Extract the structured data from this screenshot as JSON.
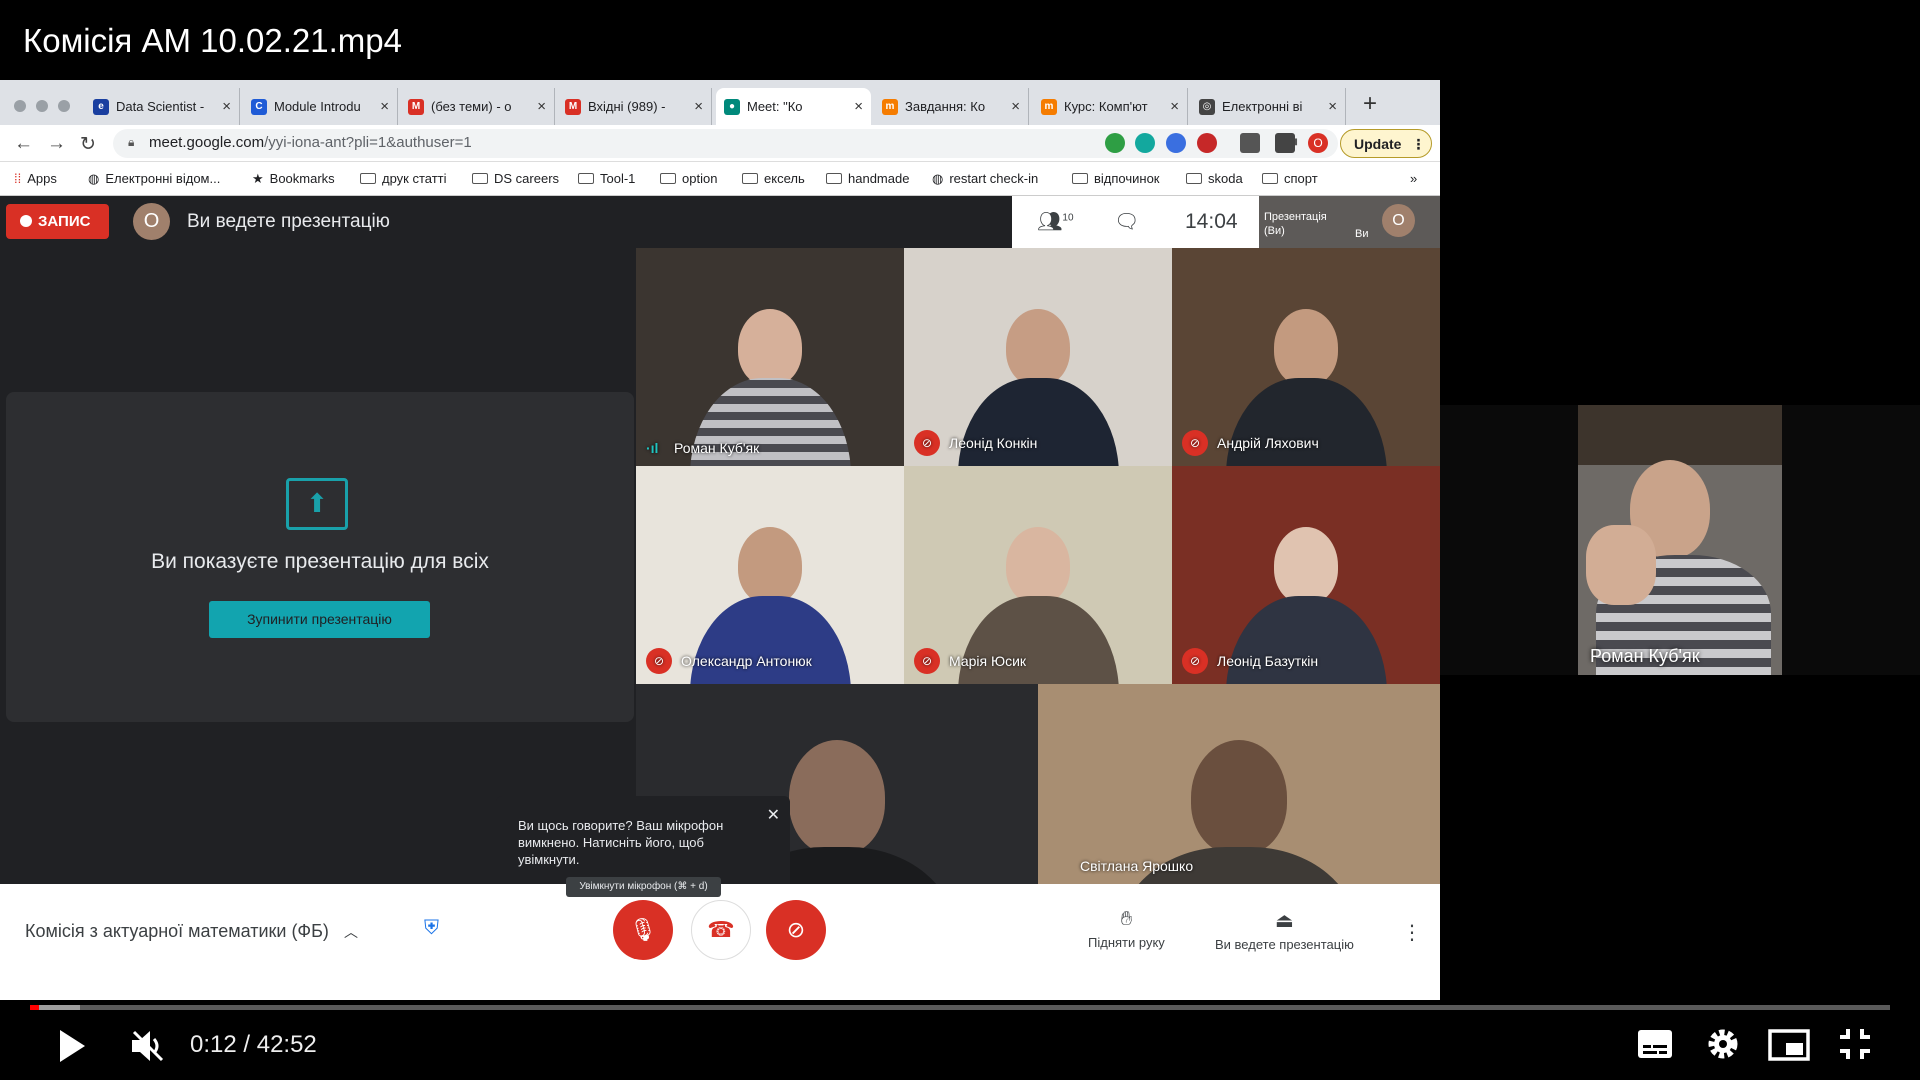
{
  "video_title": "Комісія АМ 10.02.21.mp4",
  "browser": {
    "tabs": [
      {
        "label": "Data Scientist -",
        "favicon_letter": "e",
        "color": "#1a3fa0"
      },
      {
        "label": "Module Introdu",
        "favicon_letter": "C",
        "color": "#1f5bd6"
      },
      {
        "label": "(без теми) - o",
        "favicon_letter": "M",
        "color": "#d93025"
      },
      {
        "label": "Вхідні (989) -",
        "favicon_letter": "M",
        "color": "#d93025"
      },
      {
        "label": "Meet: \"Ко",
        "favicon_letter": "●",
        "color": "#00897b"
      },
      {
        "label": "Завдання: Ко",
        "favicon_letter": "m",
        "color": "#f57c00"
      },
      {
        "label": "Курс: Комп'ют",
        "favicon_letter": "m",
        "color": "#f57c00"
      },
      {
        "label": "Електронні ві",
        "favicon_letter": "◎",
        "color": "#444444"
      }
    ],
    "new_tab": "+",
    "url_host": "meet.google.com",
    "url_path": "/yyi-iona-ant?pli=1&authuser=1",
    "update_label": "Update",
    "bookmarks": [
      "Apps",
      "Електронні відом...",
      "Bookmarks",
      "друк статті",
      "DS careers",
      "Tool-1",
      "option",
      "ексель",
      "handmade",
      "restart check-in",
      "відпочинок",
      "skoda",
      "спорт"
    ],
    "bookmarks_more": "»"
  },
  "meet": {
    "recording_label": "ЗАПИС",
    "avatar_letter": "О",
    "presenting_status": "Ви ведете презентацію",
    "participants_count": "10",
    "time": "14:04",
    "self_presentation": "Презентація (Ви)",
    "self_label": "Ви",
    "presentation_message": "Ви показуєте презентацію для всіх",
    "stop_presentation": "Зупинити презентацію",
    "participants": [
      {
        "name": "Роман Куб'як",
        "muted": false
      },
      {
        "name": "Леонід Конкін",
        "muted": true
      },
      {
        "name": "Андрій Ляхович",
        "muted": true
      },
      {
        "name": "Олександр Антонюк",
        "muted": true
      },
      {
        "name": "Марія Юсик",
        "muted": true
      },
      {
        "name": "Леонід Базуткін",
        "muted": true
      },
      {
        "name": "",
        "muted": false
      },
      {
        "name": "Світлана Ярошко",
        "muted": false
      }
    ],
    "tooltip": "Ви щось говорите? Ваш мікрофон вимкнено. Натисніть його, щоб увімкнути.",
    "kbd_hint": "Увімкнути мікрофон (⌘ + d)",
    "meeting_name": "Комісія з актуарної математики (ФБ)",
    "raise_hand": "Підняти руку",
    "presenting_button": "Ви ведете презентацію"
  },
  "side_thumb_name": "Роман Куб'як",
  "player": {
    "time_display": "0:12 / 42:52",
    "progress_fraction": 0.0047,
    "buffered_fraction": 0.027
  }
}
